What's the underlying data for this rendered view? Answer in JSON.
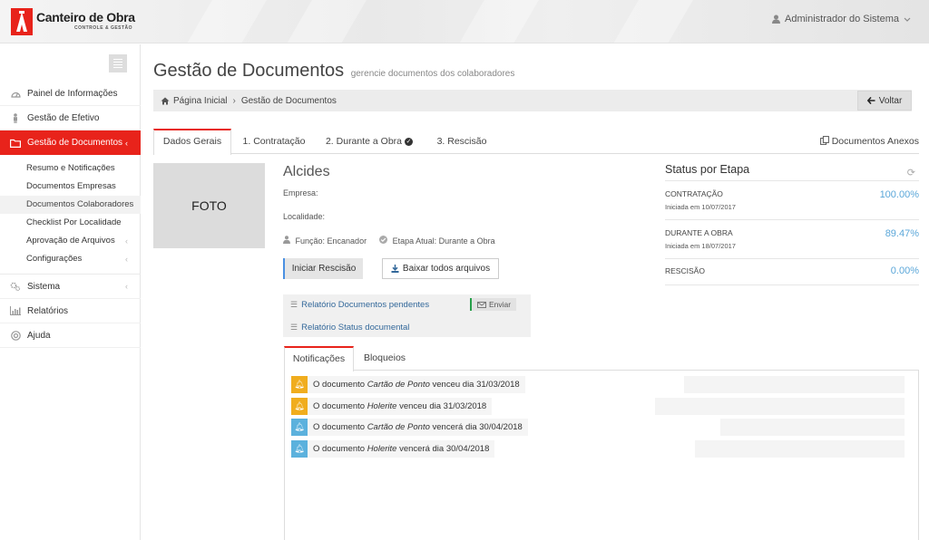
{
  "app": {
    "logo_name": "Canteiro de Obra",
    "logo_tagline": "CONTROLE & GESTÃO",
    "user_name": "Administrador do Sistema"
  },
  "sidebar": {
    "items": [
      {
        "label": "Painel de Informações",
        "icon": "dashboard-icon"
      },
      {
        "label": "Gestão de Efetivo",
        "icon": "person-icon"
      },
      {
        "label": "Gestão de Documentos",
        "icon": "folder-icon",
        "active": true
      },
      {
        "label": "Sistema",
        "icon": "gears-icon"
      },
      {
        "label": "Relatórios",
        "icon": "bar-chart-icon"
      },
      {
        "label": "Ajuda",
        "icon": "lifebuoy-icon"
      }
    ],
    "sub_items": [
      {
        "label": "Resumo e Notificações"
      },
      {
        "label": "Documentos Empresas"
      },
      {
        "label": "Documentos Colaboradores",
        "active": true
      },
      {
        "label": "Checklist Por Localidade"
      },
      {
        "label": "Aprovação de Arquivos"
      },
      {
        "label": "Configurações"
      }
    ]
  },
  "header": {
    "title": "Gestão de Documentos",
    "subtitle": "gerencie documentos dos colaboradores"
  },
  "breadcrumb": {
    "home": "Página Inicial",
    "current": "Gestão de Documentos",
    "back_label": "Voltar"
  },
  "tabs": {
    "items": [
      "Dados Gerais",
      "1. Contratação",
      "2. Durante a Obra",
      "3. Rescisão"
    ],
    "right": "Documentos Anexos"
  },
  "profile": {
    "photo_label": "FOTO",
    "name": "Alcides",
    "empresa_label": "Empresa:",
    "localidade_label": "Localidade:",
    "funcao": "Função: Encanador",
    "etapa": "Etapa Atual: Durante a Obra",
    "btn_rescisao": "Iniciar Rescisão",
    "btn_download": "Baixar todos arquivos"
  },
  "reports": {
    "pending": "Relatório Documentos pendentes",
    "send": "Enviar",
    "status": "Relatório Status documental"
  },
  "status": {
    "title": "Status por Etapa",
    "rows": [
      {
        "label": "CONTRATAÇÃO",
        "sub": "Iniciada em 10/07/2017",
        "value": "100.00%"
      },
      {
        "label": "DURANTE A OBRA",
        "sub": "Iniciada em 18/07/2017",
        "value": "89.47%"
      },
      {
        "label": "RESCISÃO",
        "sub": "",
        "value": "0.00%"
      }
    ]
  },
  "notifications": {
    "tabs": [
      "Notificações",
      "Bloqueios"
    ],
    "items": [
      {
        "prefix": "O documento",
        "doc": "Cartão de Ponto",
        "suffix": "venceu dia 31/03/2018",
        "level": "warning"
      },
      {
        "prefix": "O documento",
        "doc": "Holerite",
        "suffix": "venceu dia 31/03/2018",
        "level": "warning"
      },
      {
        "prefix": "O documento",
        "doc": "Cartão de Ponto",
        "suffix": "vencerá dia 30/04/2018",
        "level": "info"
      },
      {
        "prefix": "O documento",
        "doc": "Holerite",
        "suffix": "vencerá dia 30/04/2018",
        "level": "info"
      }
    ]
  },
  "colors": {
    "accent": "#e8231b",
    "link": "#33689a",
    "percent": "#5ba7d9",
    "warning": "#f0ad1e",
    "info": "#5bb1dd"
  }
}
